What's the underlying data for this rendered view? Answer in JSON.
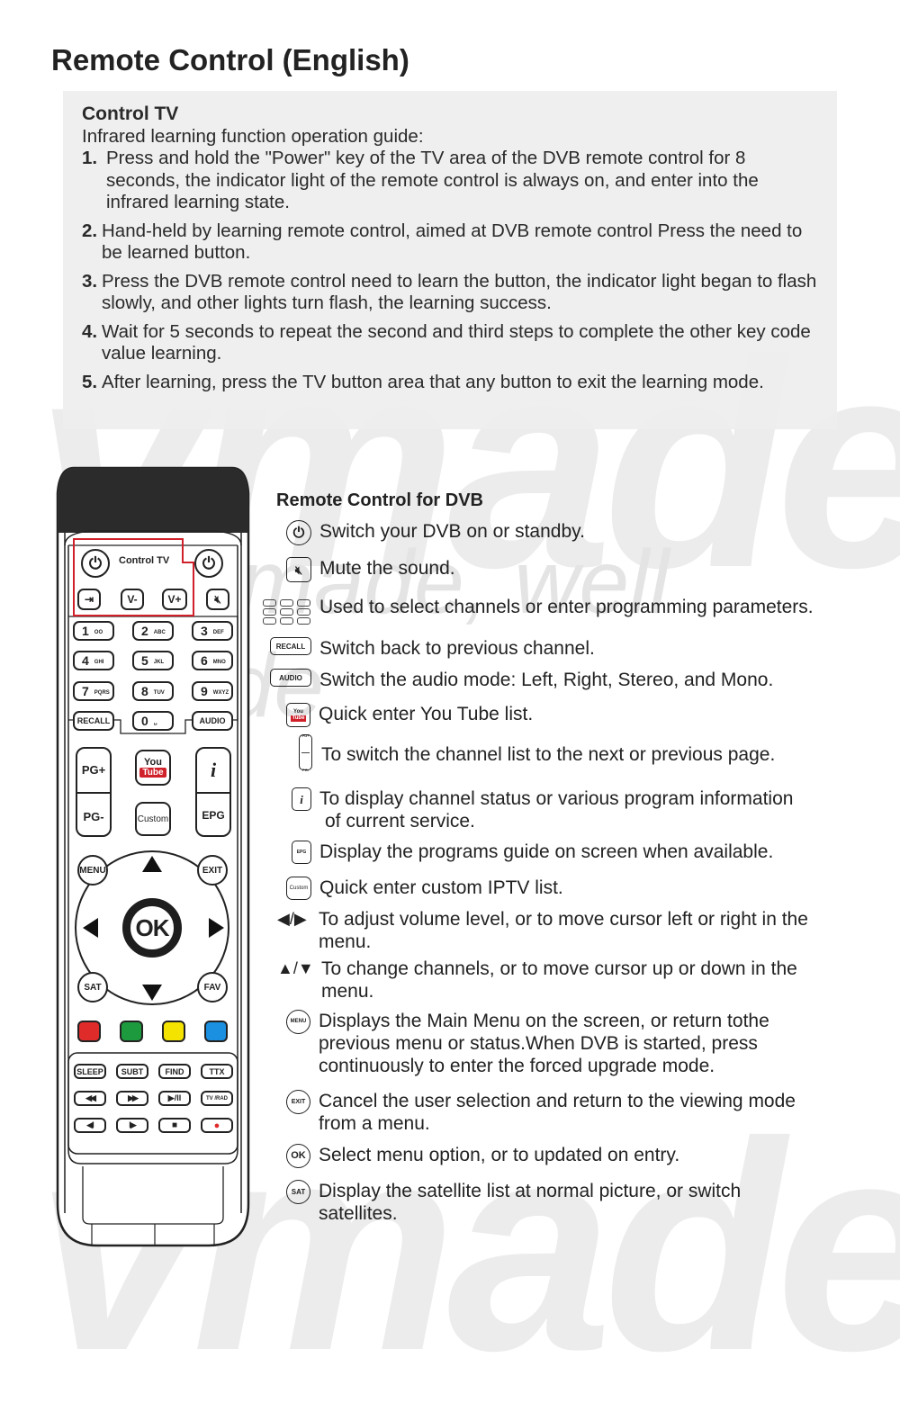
{
  "watermark": {
    "main": "vmade",
    "tagline": "we made, well made"
  },
  "page_title": "Remote Control (English)",
  "control_tv": {
    "title": "Control TV",
    "subtitle": "Infrared learning function operation guide:",
    "steps": [
      {
        "num": "1.",
        "text": "Press and hold the \"Power\" key of the TV area of the DVB remote control for 8 seconds, the indicator light of the remote control is always on, and enter into the infrared learning state."
      },
      {
        "num": "2.",
        "text": "Hand-held by learning remote control, aimed at DVB remote control Press the need to be learned button."
      },
      {
        "num": "3.",
        "text": "Press the DVB remote control need to learn the button, the indicator light began to flash slowly, and other lights turn flash, the learning success."
      },
      {
        "num": "4.",
        "text": "Wait for 5 seconds to repeat the second and third steps to complete the other key code value learning."
      },
      {
        "num": "5.",
        "text": "After learning, press the TV button area that any button to exit the learning mode."
      }
    ]
  },
  "remote": {
    "control_tv_label": "Control TV",
    "tv_buttons": {
      "vol_down": "V-",
      "vol_up": "V+"
    },
    "numbers": [
      {
        "digit": "1",
        "letters": "OO"
      },
      {
        "digit": "2",
        "letters": "ABC"
      },
      {
        "digit": "3",
        "letters": "DEF"
      },
      {
        "digit": "4",
        "letters": "GHI"
      },
      {
        "digit": "5",
        "letters": "JKL"
      },
      {
        "digit": "6",
        "letters": "MNO"
      },
      {
        "digit": "7",
        "letters": "PQRS"
      },
      {
        "digit": "8",
        "letters": "TUV"
      },
      {
        "digit": "9",
        "letters": "WXYZ"
      },
      {
        "digit": "0",
        "letters": "␣"
      }
    ],
    "recall": "RECALL",
    "audio": "AUDIO",
    "pg_up": "PG+",
    "pg_down": "PG-",
    "youtube_top": "You",
    "youtube_bottom": "Tube",
    "custom": "Custom",
    "info": "i",
    "epg": "EPG",
    "menu": "MENU",
    "exit": "EXIT",
    "ok": "OK",
    "sat": "SAT",
    "fav": "FAV",
    "colors": [
      "#e02b2b",
      "#1e9a3e",
      "#f4e300",
      "#1b8fe0"
    ],
    "func_row": [
      "SLEEP",
      "SUBT",
      "FIND",
      "TTX"
    ],
    "media_row1": [
      "◀◀",
      "▶▶",
      "▶/II",
      "TV /RAD"
    ],
    "media_row2": [
      "◀I",
      "I▶",
      "■",
      "●"
    ],
    "accent_red": "#d0202a"
  },
  "dvb": {
    "title": "Remote Control for DVB",
    "items": [
      {
        "icon": "power",
        "label": "",
        "text": "Switch your DVB on or standby."
      },
      {
        "icon": "mute",
        "label": "",
        "text": "Mute the sound."
      },
      {
        "icon": "numpad",
        "label": "",
        "text": "Used to select channels or enter programming parameters."
      },
      {
        "icon": "recall",
        "label": "RECALL",
        "text": "Switch back to previous channel."
      },
      {
        "icon": "audio",
        "label": "AUDIO",
        "text": "Switch the audio mode: Left, Right, Stereo, and Mono."
      },
      {
        "icon": "youtube",
        "label": "You Tube",
        "text": "Quick enter You Tube list."
      },
      {
        "icon": "pg",
        "label": "PG+ PG-",
        "text": "To switch the channel list to the next or previous page."
      },
      {
        "icon": "info",
        "label": "i",
        "text": "To display channel status or various program information",
        "text2": "of current service."
      },
      {
        "icon": "epg",
        "label": "EPG",
        "text": "Display the programs guide on screen when available."
      },
      {
        "icon": "custom",
        "label": "Custom",
        "text": "Quick enter custom IPTV list."
      },
      {
        "icon": "left-right",
        "label": "◀/▶",
        "text": "To adjust volume level, or to move cursor left or right in the",
        "text2": "menu."
      },
      {
        "icon": "up-down",
        "label": "▲/▼",
        "text": "To change channels, or to move cursor up or down  in the",
        "text2": "menu."
      },
      {
        "icon": "menu",
        "label": "MENU",
        "text": "Displays the Main Menu on the screen, or return tothe",
        "text2": "previous menu or status.When DVB is started, press",
        "text3": "continuously to enter the forced upgrade mode."
      },
      {
        "icon": "exit",
        "label": "EXIT",
        "text": "Cancel the user selection and return to the viewing mode",
        "text2": "from  a menu."
      },
      {
        "icon": "ok",
        "label": "OK",
        "text": "Select menu option, or to updated on entry."
      },
      {
        "icon": "sat",
        "label": "SAT",
        "text": "Display the satellite list at normal picture, or switch",
        "text2": "satellites."
      }
    ]
  }
}
